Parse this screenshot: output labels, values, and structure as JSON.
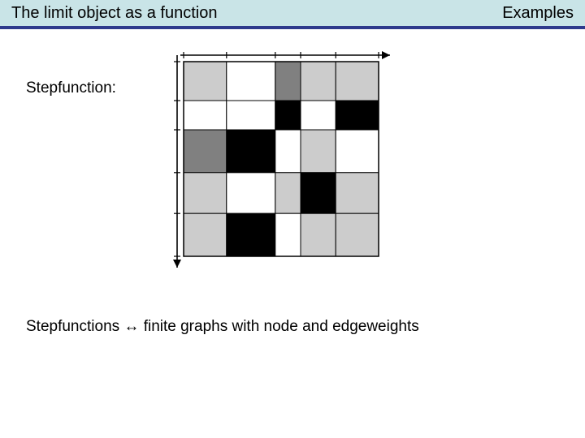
{
  "header": {
    "title_left": "The limit object as a function",
    "title_right": "Examples"
  },
  "body": {
    "label": "Stepfunction:",
    "statement": "Stepfunctions  ↔  finite graphs with node and edgeweights"
  },
  "chart_data": {
    "type": "heatmap",
    "title": "",
    "xlabel": "",
    "ylabel": "",
    "x_breaks": [
      0,
      0.22,
      0.47,
      0.6,
      0.78,
      1.0
    ],
    "y_breaks": [
      0,
      0.2,
      0.35,
      0.57,
      0.78,
      1.0
    ],
    "palette": {
      "0": "#ffffff",
      "0.4": "#cccccc",
      "0.6": "#808080",
      "1": "#000000"
    },
    "values": [
      [
        0.4,
        0.0,
        0.6,
        0.4,
        0.4
      ],
      [
        0.0,
        0.0,
        1.0,
        0.0,
        1.0
      ],
      [
        0.6,
        1.0,
        0.0,
        0.4,
        0.0
      ],
      [
        0.4,
        0.0,
        0.4,
        1.0,
        0.4
      ],
      [
        0.4,
        1.0,
        0.0,
        0.4,
        0.4
      ]
    ]
  }
}
